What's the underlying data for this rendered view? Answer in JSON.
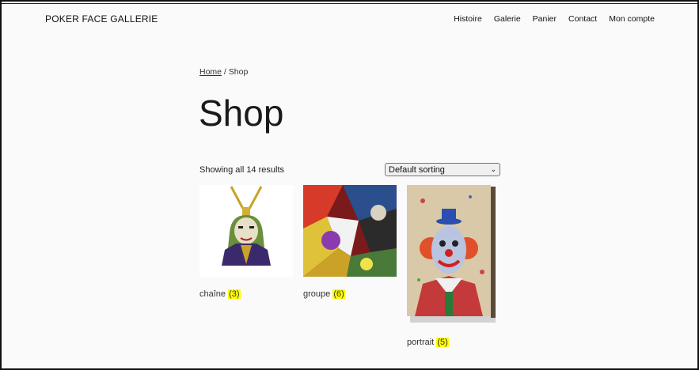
{
  "header": {
    "site_title": "POKER FACE GALLERIE",
    "nav": [
      "Histoire",
      "Galerie",
      "Panier",
      "Contact",
      "Mon compte"
    ]
  },
  "breadcrumb": {
    "home": "Home",
    "separator": " / ",
    "current": "Shop"
  },
  "page": {
    "title": "Shop"
  },
  "results": {
    "count_text": "Showing all 14 results"
  },
  "sort": {
    "selected": "Default sorting"
  },
  "categories": [
    {
      "name": "chaîne",
      "count": "(3)"
    },
    {
      "name": "groupe",
      "count": "(6)"
    },
    {
      "name": "portrait",
      "count": "(5)"
    }
  ],
  "colors": {
    "highlight": "#ffff00",
    "background": "#fafafa"
  }
}
